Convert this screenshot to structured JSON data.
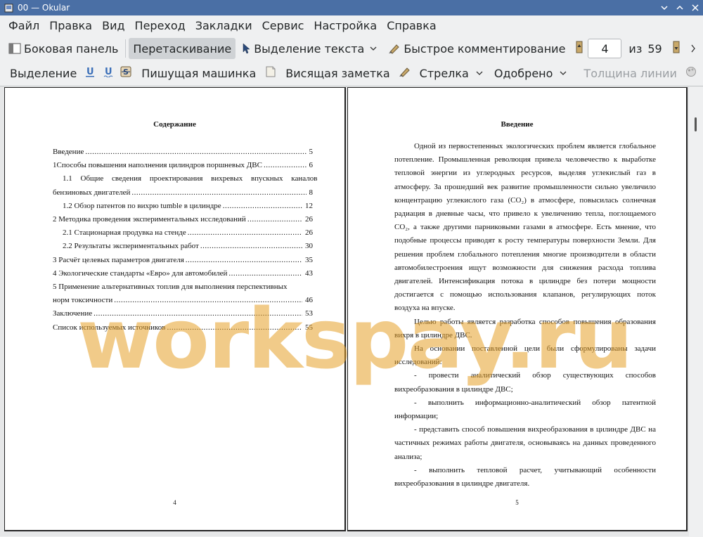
{
  "window": {
    "title": "00  — Okular",
    "controls": [
      "minimize-icon",
      "maximize-icon",
      "close-icon"
    ]
  },
  "menu": [
    "Файл",
    "Правка",
    "Вид",
    "Переход",
    "Закладки",
    "Сервис",
    "Настройка",
    "Справка"
  ],
  "toolbar1": {
    "sidebar": "Боковая панель",
    "drag": "Перетаскивание",
    "text_select": "Выделение текста",
    "quick_comment": "Быстрое комментирование",
    "current_page": "4",
    "of_label": "из",
    "total_pages": "59"
  },
  "toolbar2": {
    "selection": "Выделение",
    "typewriter": "Пишущая машинка",
    "hanging_note": "Висящая заметка",
    "arrow": "Стрелка",
    "approved": "Одобрено",
    "line_width": "Толщина линии"
  },
  "left_page": {
    "title": "Содержание",
    "toc": [
      {
        "text": "Введение",
        "page": "5"
      },
      {
        "text": "1Способы повышения наполнения цилиндров поршневых ДВС",
        "page": "6"
      },
      {
        "text": "1.1 Общие сведения проектирования вихревых впускных каналов",
        "page": ""
      },
      {
        "text": "бензиновых двигателей",
        "page": "8"
      },
      {
        "text": "1.2 Обзор патентов по вихрю tumble в цилиндре",
        "page": "12"
      },
      {
        "text": "2 Методика проведения экспериментальных исследований",
        "page": "26"
      },
      {
        "text": "2.1 Стационарная продувка на стенде",
        "page": "26"
      },
      {
        "text": "2.2 Результаты экспериментальных работ",
        "page": "30"
      },
      {
        "text": "3 Расчёт целевых параметров двигателя",
        "page": "35"
      },
      {
        "text": "4 Экологические стандарты «Евро» для автомобилей",
        "page": "43"
      },
      {
        "text": "5 Применение альтернативных топлив для выполнения перспективных",
        "page": ""
      },
      {
        "text": "норм токсичности",
        "page": "46"
      },
      {
        "text": "Заключение",
        "page": "53"
      },
      {
        "text": "Список используемых источников",
        "page": "55"
      }
    ],
    "page_number": "4"
  },
  "right_page": {
    "title": "Введение",
    "paragraphs": [
      "Одной из первостепенных экологических проблем является глобальное потепление. Промышленная революция привела человечество к выработке тепловой энергии из углеродных ресурсов, выделяя углекислый газ в атмосферу. За прошедший век развитие промышленности сильно увеличило концентрацию углекислого газа (CO₂) в атмосфере, повысилась солнечная радиация в дневные часы, что  привело к увеличению тепла, поглощаемого CO₂, а также другими парниковыми газами в атмосфере. Есть мнение, что подобные процессы приводят к росту температуры поверхности Земли. Для решения проблем глобального потепления многие производители в области автомобилестроения ищут возможности для снижения расхода топлива двигателей. Интенсификация потока в цилиндре без потери мощности достигается с помощью использования клапанов, регулирующих поток воздуха на впуске.",
      "Целью работы является разработка способов повышения образования вихря в цилиндре ДВС.",
      "На основании поставленной цели были сформулированы задачи исследований:",
      "-    провести    аналитический    обзор    существующих    способов вихреобразования в цилиндре ДВС;",
      "-    выполнить    информационно-аналитический    обзор    патентной информации;",
      "- представить способ повышения вихреобразования в цилиндре ДВС на частичных режимах работы двигателя, основываясь на данных проведенного анализа;",
      "-    выполнить    тепловой    расчет,    учитывающий    особенности вихреобразования в цилиндре двигателя."
    ],
    "page_number": "5"
  },
  "watermark": "workspay.ru"
}
